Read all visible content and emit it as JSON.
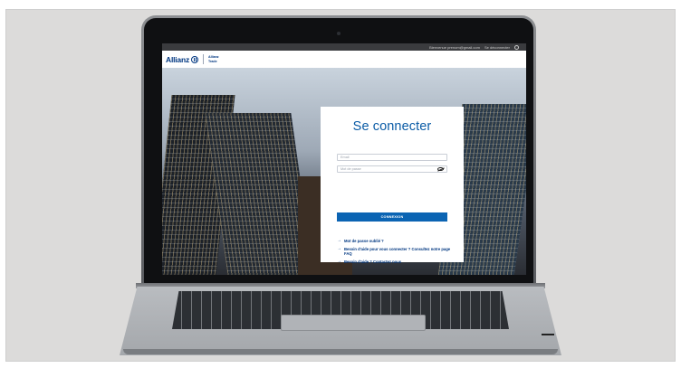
{
  "utility_bar": {
    "email": "Bienvenue prenom@gmail.com",
    "logout": "Se déconnecter"
  },
  "header": {
    "brand": "Allianz",
    "sub_line1": "Allianz",
    "sub_line2": "Trade"
  },
  "login": {
    "title": "Se connecter",
    "email_placeholder": "Email",
    "password_placeholder": "Mot de passe",
    "submit_label": "CONNEXION",
    "links": [
      "Mot de passe oublié ?",
      "Besoin d'aide pour vous connecter ? Consultez notre page FAQ",
      "Besoin d'aide ? Contactez nous"
    ]
  },
  "icons": {
    "password_toggle": "eye-slash-icon",
    "link_arrow": "arrow-right-icon"
  },
  "colors": {
    "brand_blue": "#003781",
    "title_blue": "#0a5ba6",
    "button_blue": "#0b64b3"
  }
}
